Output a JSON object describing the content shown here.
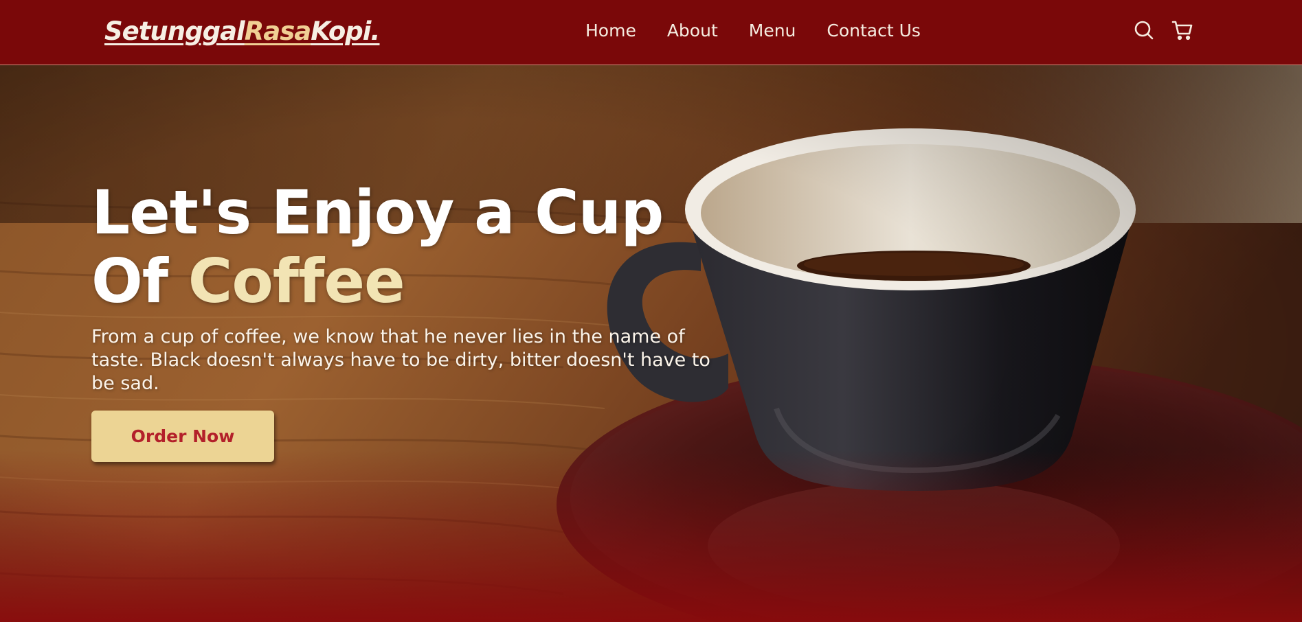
{
  "brand": {
    "part1": "Setunggal",
    "part2": "Rasa",
    "part3": "Kopi."
  },
  "nav": {
    "links": [
      "Home",
      "About",
      "Menu",
      "Contact Us"
    ],
    "icons": [
      "search-icon",
      "cart-icon"
    ]
  },
  "hero": {
    "title_line1": "Let's Enjoy a Cup",
    "title_of": "Of",
    "title_accent": "Coffee",
    "text": "From a cup of coffee, we know that he never lies in the name of taste. Black doesn't always have to be dirty, bitter doesn't have to be sad.",
    "button_label": "Order Now"
  },
  "colors": {
    "navbar": "#7a0809",
    "brand_accent": "#f0cf94",
    "title_accent": "#f2e4b4",
    "button_bg": "#ecd494",
    "button_text": "#b3202a"
  }
}
